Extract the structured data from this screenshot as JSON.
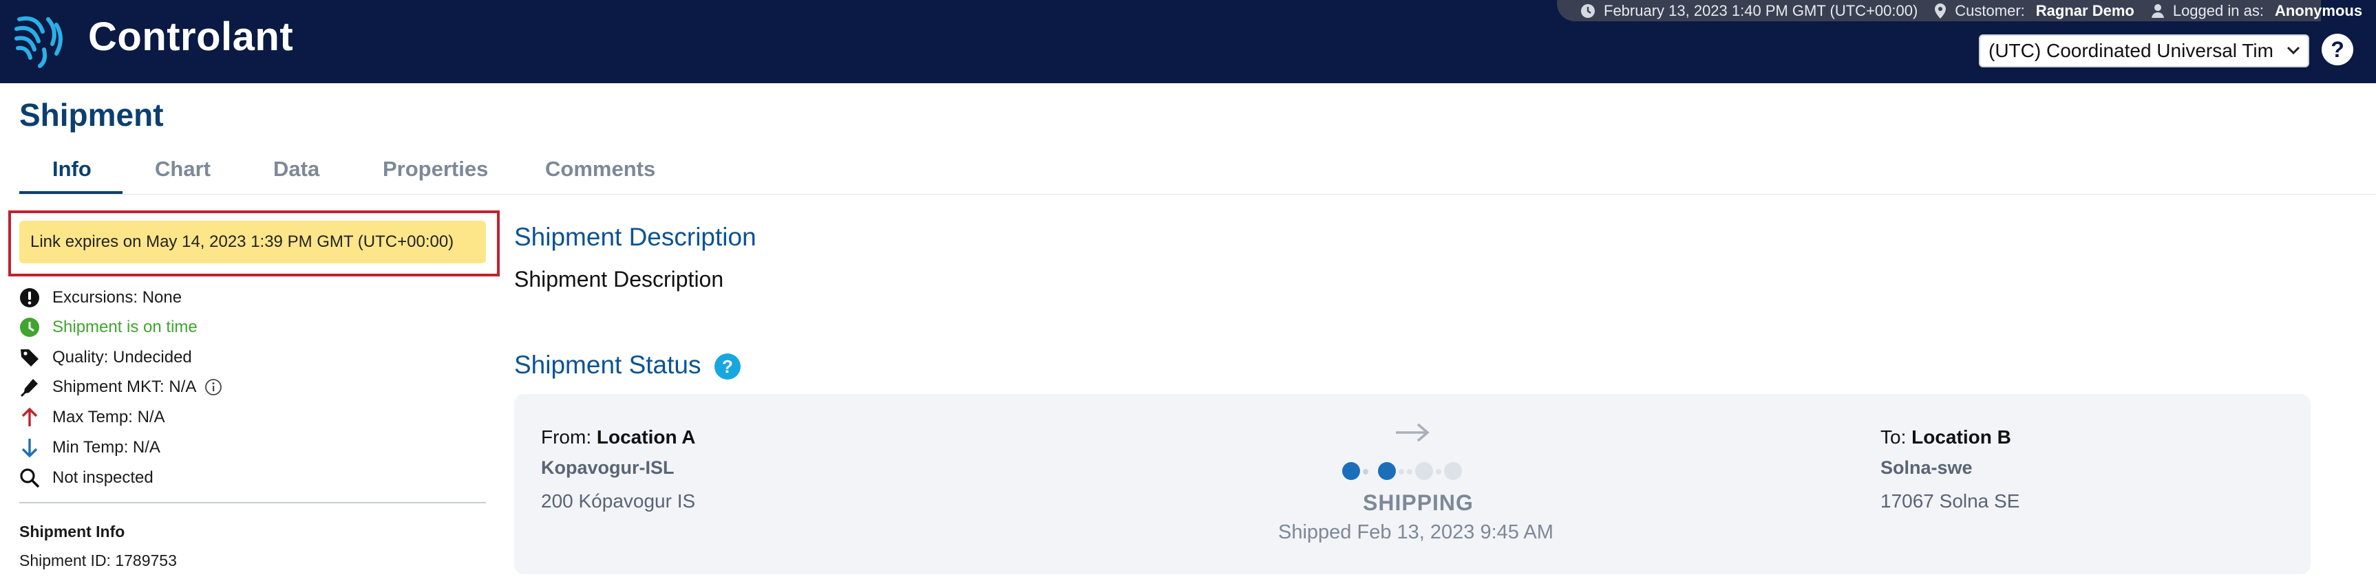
{
  "header": {
    "brand": "Controlant",
    "datetime": "February 13, 2023 1:40 PM GMT (UTC+00:00)",
    "customer_label": "Customer:",
    "customer_name": "Ragnar Demo",
    "logged_label": "Logged in as:",
    "logged_user": "Anonymous",
    "timezone": "(UTC) Coordinated Universal Tim",
    "help": "?"
  },
  "page": {
    "title": "Shipment"
  },
  "tabs": [
    {
      "label": "Info",
      "active": true
    },
    {
      "label": "Chart"
    },
    {
      "label": "Data"
    },
    {
      "label": "Properties"
    },
    {
      "label": "Comments"
    }
  ],
  "sidebar": {
    "expiry": "Link expires on May 14, 2023 1:39 PM GMT (UTC+00:00)",
    "rows": [
      {
        "icon": "exclamation-icon",
        "text": "Excursions: None"
      },
      {
        "icon": "clock-icon",
        "text": "Shipment is on time"
      },
      {
        "icon": "tag-icon",
        "text": "Quality: Undecided"
      },
      {
        "icon": "thermometer-icon",
        "text": "Shipment MKT: N/A"
      },
      {
        "icon": "arrow-up-icon",
        "text": "Max Temp: N/A"
      },
      {
        "icon": "arrow-down-icon",
        "text": "Min Temp: N/A"
      },
      {
        "icon": "magnifier-icon",
        "text": "Not inspected"
      }
    ],
    "info_heading": "Shipment Info",
    "shipment_id": "Shipment ID: 1789753"
  },
  "main": {
    "description_heading": "Shipment Description",
    "description_text": "Shipment Description",
    "status_heading": "Shipment Status",
    "status_help": "?",
    "from": {
      "label": "From:",
      "name": "Location A",
      "code": "Kopavogur-ISL",
      "address": "200 Kópavogur IS"
    },
    "to": {
      "label": "To:",
      "name": "Location B",
      "code": "Solna-swe",
      "address": "17067 Solna SE"
    },
    "state": "SHIPPING",
    "shipped": "Shipped Feb 13, 2023 9:45 AM",
    "progress": {
      "steps": 7,
      "completed": 2
    }
  },
  "colors": {
    "navy": "#0a1a44",
    "accent_blue": "#0b5394",
    "banner_yellow": "#fde68a",
    "highlight_red": "#c0232e",
    "on_time_green": "#3fa52f"
  }
}
